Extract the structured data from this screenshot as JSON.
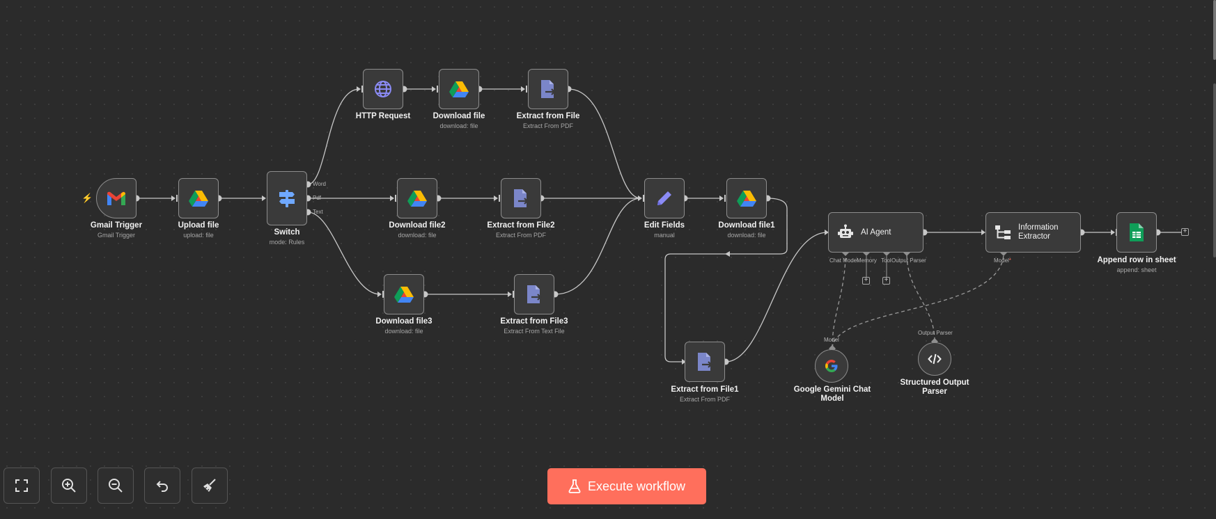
{
  "nodes": {
    "gmail_trigger": {
      "title": "Gmail Trigger",
      "subtitle": "Gmail Trigger"
    },
    "upload_file": {
      "title": "Upload file",
      "subtitle": "upload: file"
    },
    "switch": {
      "title": "Switch",
      "subtitle": "mode: Rules",
      "outputs": [
        "Word",
        "Pdf",
        "Text"
      ]
    },
    "http_request": {
      "title": "HTTP Request",
      "subtitle": ""
    },
    "download_file": {
      "title": "Download file",
      "subtitle": "download: file"
    },
    "extract_from_file": {
      "title": "Extract from File",
      "subtitle": "Extract From PDF"
    },
    "download_file2": {
      "title": "Download file2",
      "subtitle": "download: file"
    },
    "extract_from_file2": {
      "title": "Extract from File2",
      "subtitle": "Extract From PDF"
    },
    "download_file3": {
      "title": "Download file3",
      "subtitle": "download: file"
    },
    "extract_from_file3": {
      "title": "Extract from File3",
      "subtitle": "Extract From Text File"
    },
    "edit_fields": {
      "title": "Edit Fields",
      "subtitle": "manual"
    },
    "download_file1": {
      "title": "Download file1",
      "subtitle": "download: file"
    },
    "extract_from_file1": {
      "title": "Extract from File1",
      "subtitle": "Extract From PDF"
    },
    "ai_agent": {
      "title": "AI Agent",
      "ports": {
        "chat_model": "Chat Model",
        "memory": "Memory",
        "tool": "Tool",
        "output_parser": "Output Parser"
      }
    },
    "information_extractor": {
      "title_line1": "Information",
      "title_line2": "Extractor",
      "port_model": "Model",
      "required_mark": "*"
    },
    "append_row": {
      "title": "Append row in sheet",
      "subtitle": "append: sheet"
    },
    "gemini": {
      "title_line1": "Google Gemini Chat",
      "title_line2": "Model",
      "port_label": "Model"
    },
    "output_parser": {
      "title_line1": "Structured Output",
      "title_line2": "Parser",
      "port_label": "Output Parser"
    }
  },
  "controls": {
    "fit_view": "fit-view-icon",
    "zoom_in": "zoom-in-icon",
    "zoom_out": "zoom-out-icon",
    "undo": "undo-icon",
    "tidy_up": "broom-icon"
  },
  "execute_button": {
    "label": "Execute workflow"
  },
  "colors": {
    "background": "#2b2b2b",
    "node_bg": "#3a3a3a",
    "node_border": "#8d8d8d",
    "edge": "#c8c8c8",
    "execute": "#ff6f5c",
    "trigger_bolt": "#ff6f5c",
    "required": "#ff6f5c"
  }
}
